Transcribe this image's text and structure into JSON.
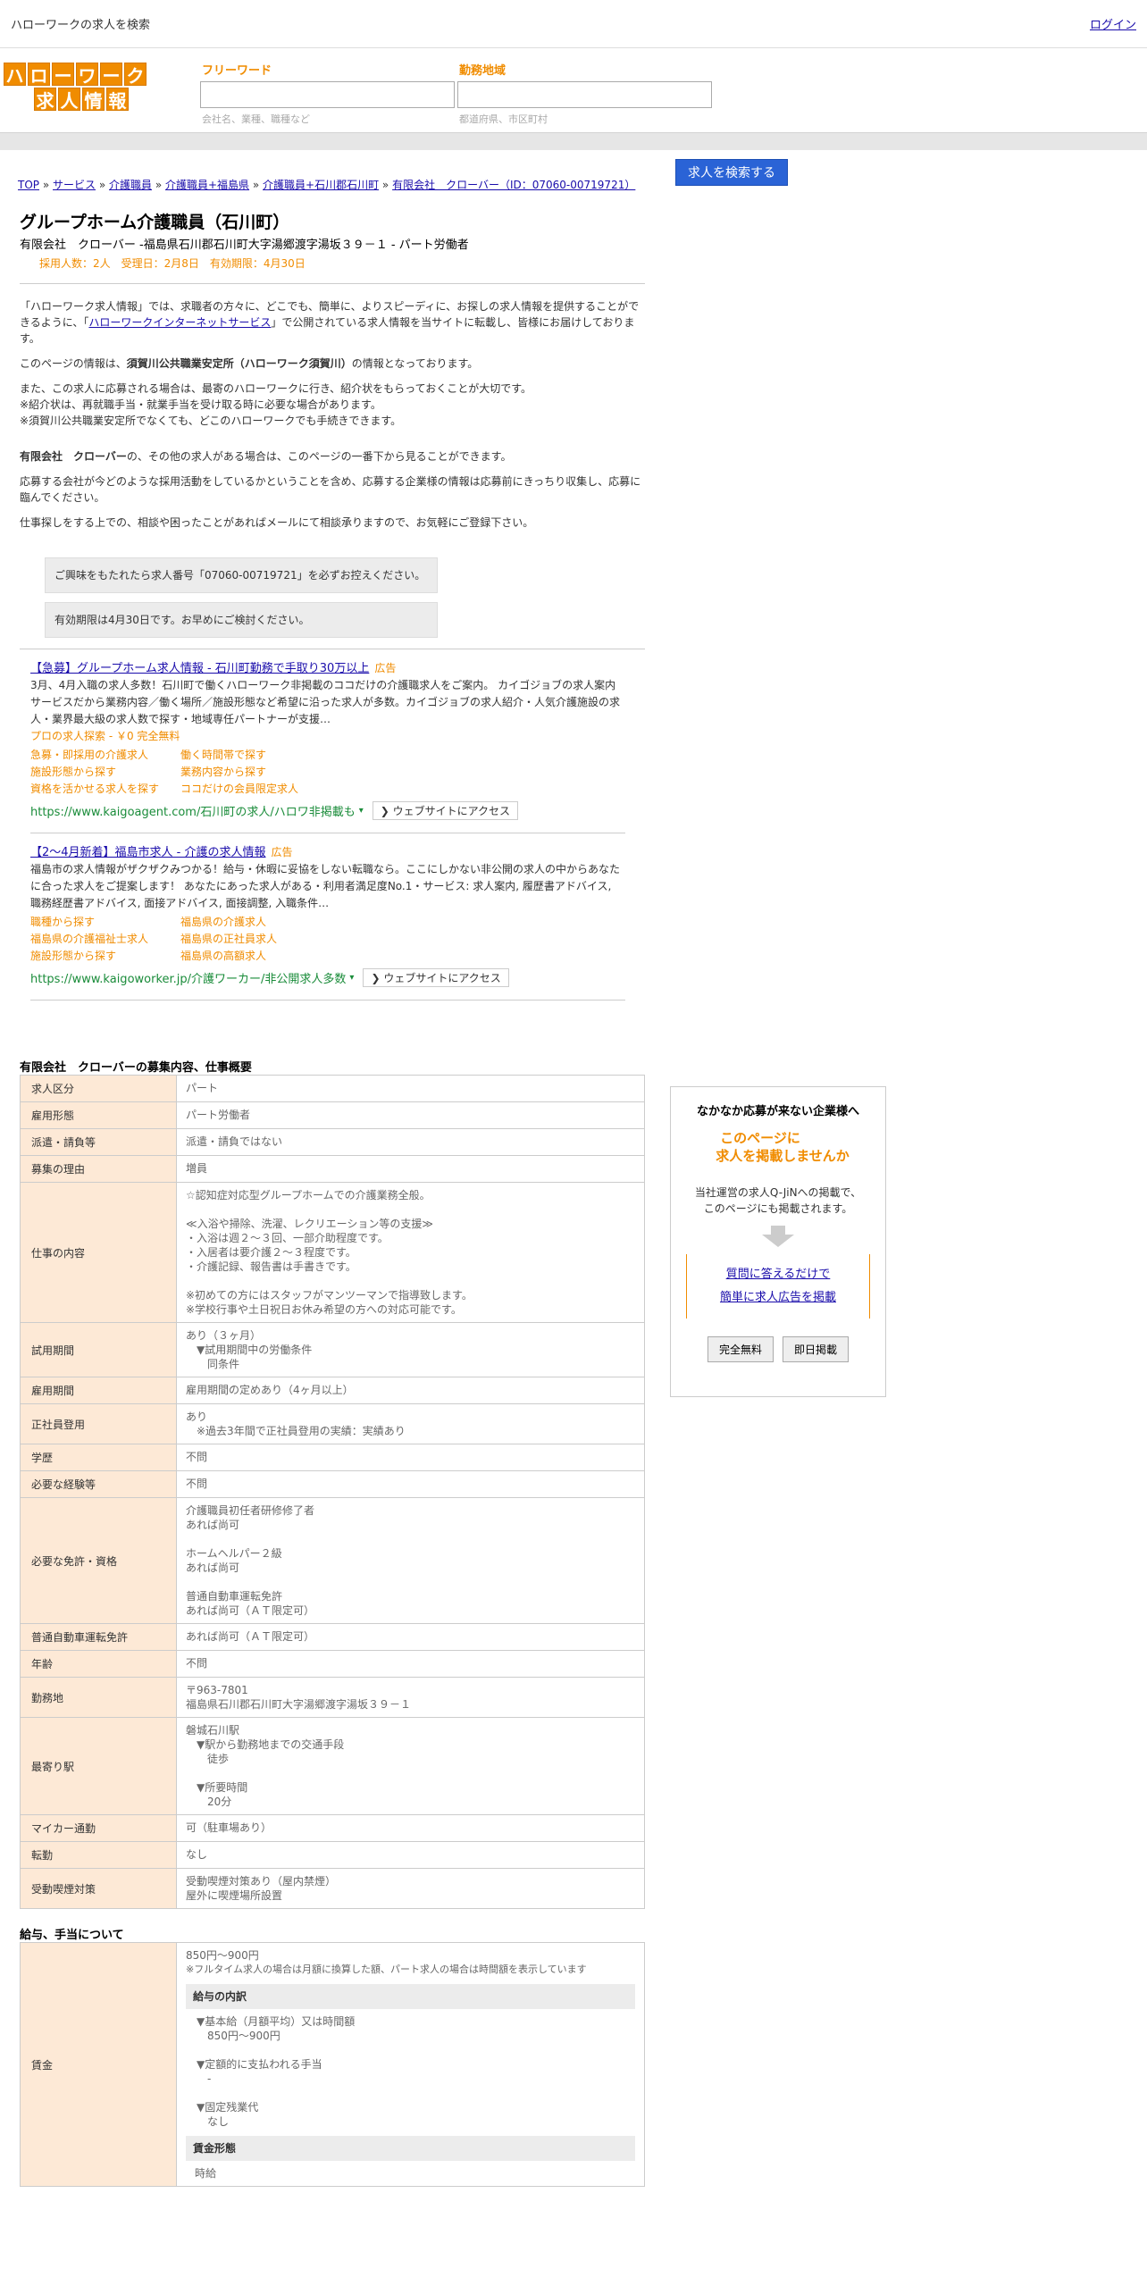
{
  "topbar": {
    "title": "ハローワークの求人を検索",
    "login": "ログイン"
  },
  "logo": {
    "row1": [
      "ハ",
      "ロ",
      "ー",
      "ワ",
      "ー",
      "ク"
    ],
    "row2": [
      "求",
      "人",
      "情",
      "報"
    ]
  },
  "search": {
    "keyword_label": "フリーワード",
    "keyword_hint": "会社名、業種、職種など",
    "area_label": "勤務地域",
    "area_hint": "都道府県、市区町村",
    "button": "求人を検索する"
  },
  "breadcrumb": {
    "items": [
      "TOP",
      "サービス",
      "介護職員",
      "介護職員+福島県",
      "介護職員+石川郡石川町",
      "有限会社　クローバー（ID：07060-00719721）"
    ],
    "sep": " » "
  },
  "job": {
    "title": "グループホーム介護職員（石川町）",
    "company_line": "有限会社　クローバー -福島県石川郡石川町大字湯郷渡字湯坂３９－１ - パート労働者",
    "meta": "採用人数：2人　受理日：2月8日　有効期限：4月30日"
  },
  "intro": {
    "p1a": "「ハローワーク求人情報」では、求職者の方々に、どこでも、簡単に、よりスピーディに、お探しの求人情報を提供することができるように、「",
    "p1link": "ハローワークインターネットサービス",
    "p1b": "」で公開されている求人情報を当サイトに転載し、皆様にお届けしております。",
    "p2a": "このページの情報は、",
    "p2bold": "須賀川公共職業安定所（ハローワーク須賀川）",
    "p2b": "の情報となっております。",
    "p3l1": "また、この求人に応募される場合は、最寄のハローワークに行き、紹介状をもらっておくことが大切です。",
    "p3l2": "※紹介状は、再就職手当・就業手当を受け取る時に必要な場合があります。",
    "p3l3": "※須賀川公共職業安定所でなくても、どこのハローワークでも手続きできます。",
    "p4bold": "有限会社　クローバー",
    "p4": "の、その他の求人がある場合は、このページの一番下から見ることができます。",
    "p5": "応募する会社が今どのような採用活動をしているかということを含め、応募する企業様の情報は応募前にきっちり収集し、応募に臨んでください。",
    "p6": "仕事探しをする上での、相談や困ったことがあればメールにて相談承りますので、お気軽にご登録下さい。",
    "notice1": "ご興味をもたれたら求人番号「07060-00719721」を必ずお控えください。",
    "notice2": "有効期限は4月30日です。お早めにご検討ください。"
  },
  "ads": [
    {
      "title": "【急募】グループホーム求人情報 - 石川町勤務で手取り30万以上",
      "badge": "広告",
      "body": "3月、4月入職の求人多数！石川町で働くハローワーク非掲載のココだけの介護職求人をご案内。 カイゴジョブの求人案内サービスだから業務内容／働く場所／施設形態など希望に沿った求人が多数。カイゴジョブの求人紹介・人気介護施設の求人・業界最大級の求人数で探す・地域専任パートナーが支援…",
      "sub": "プロの求人探索 - ￥0 完全無料",
      "links": [
        "急募・即採用の介護求人",
        "働く時間帯で探す",
        "施設形態から探す",
        "業務内容から探す",
        "資格を活かせる求人を探す",
        "ココだけの会員限定求人"
      ],
      "url": "https://www.kaigoagent.com/石川町の求人/ハロワ非掲載も",
      "visit": "❯ ウェブサイトにアクセス"
    },
    {
      "title": "【2～4月新着】福島市求人 - 介護の求人情報",
      "badge": "広告",
      "body": "福島市の求人情報がザクザクみつかる！給与・休暇に妥協をしない転職なら。ここにしかない非公開の求人の中からあなたに合った求人をご提案します！ あなたにあった求人がある・利用者満足度No.1・サービス: 求人案内, 履歴書アドバイス, 職務経歴書アドバイス, 面接アドバイス, 面接調整, 入職条件…",
      "sub": "",
      "links": [
        "職種から探す",
        "福島県の介護求人",
        "福島県の介護福祉士求人",
        "福島県の正社員求人",
        "施設形態から探す",
        "福島県の高額求人"
      ],
      "url": "https://www.kaigoworker.jp/介護ワーカー/非公開求人多数",
      "visit": "❯ ウェブサイトにアクセス"
    }
  ],
  "details": {
    "title": "有限会社　クローバーの募集内容、仕事概要",
    "rows": [
      {
        "label": "求人区分",
        "value": "パート"
      },
      {
        "label": "雇用形態",
        "value": "パート労働者"
      },
      {
        "label": "派遣・請負等",
        "value": "派遣・請負ではない"
      },
      {
        "label": "募集の理由",
        "value": "増員"
      },
      {
        "label": "仕事の内容",
        "value": "☆認知症対応型グループホームでの介護業務全般。\n\n≪入浴や掃除、洗濯、レクリエーション等の支援≫\n・入浴は週２～３回、一部介助程度です。\n・入居者は要介護２～３程度です。\n・介護記録、報告書は手書きです。\n\n※初めての方にはスタッフがマンツーマンで指導致します。\n※学校行事や土日祝日お休み希望の方への対応可能です。"
      },
      {
        "label": "試用期間",
        "value": "あり（３ヶ月）\n　▼試用期間中の労働条件\n　　同条件"
      },
      {
        "label": "雇用期間",
        "value": "雇用期間の定めあり（4ヶ月以上）"
      },
      {
        "label": "正社員登用",
        "value": "あり\n　※過去3年間で正社員登用の実績：実績あり"
      },
      {
        "label": "学歴",
        "value": "不問"
      },
      {
        "label": "必要な経験等",
        "value": "不問"
      },
      {
        "label": "必要な免許・資格",
        "value": "介護職員初任者研修修了者\nあれば尚可\n\nホームヘルパー２級\nあれば尚可\n\n普通自動車運転免許\nあれば尚可（ＡＴ限定可）"
      },
      {
        "label": "普通自動車運転免許",
        "value": "あれば尚可（ＡＴ限定可）"
      },
      {
        "label": "年齢",
        "value": "不問"
      },
      {
        "label": "勤務地",
        "value": "〒963-7801\n福島県石川郡石川町大字湯郷渡字湯坂３９－１"
      },
      {
        "label": "最寄り駅",
        "value": "磐城石川駅\n　▼駅から勤務地までの交通手段\n　　徒歩\n\n　▼所要時間\n　　20分"
      },
      {
        "label": "マイカー通勤",
        "value": "可（駐車場あり）"
      },
      {
        "label": "転勤",
        "value": "なし"
      },
      {
        "label": "受動喫煙対策",
        "value": "受動喫煙対策あり（屋内禁煙）\n屋外に喫煙場所設置"
      }
    ]
  },
  "pay": {
    "title": "給与、手当について",
    "label": "賃金",
    "amount": "850円〜900円",
    "note": "※フルタイム求人の場合は月額に換算した額、パート求人の場合は時間額を表示しています",
    "sub1": "給与の内訳",
    "breakdown": "　▼基本給（月額平均）又は時間額\n　　850円〜900円\n\n　▼定額的に支払われる手当\n　　-\n\n　▼固定残業代\n　　なし",
    "sub2": "賃金形態",
    "form": "時給"
  },
  "sidebox": {
    "title": "なかなか応募が来ない企業様へ",
    "orange1": "このページに",
    "orange2": "求人を掲載しませんか",
    "text1": "当社運営の求人Q-JiNへの掲載で、",
    "text2": "このページにも掲載されます。",
    "link1": "質問に答えるだけで",
    "link2": "簡単に求人広告を掲載",
    "btn1": "完全無料",
    "btn2": "即日掲載"
  }
}
